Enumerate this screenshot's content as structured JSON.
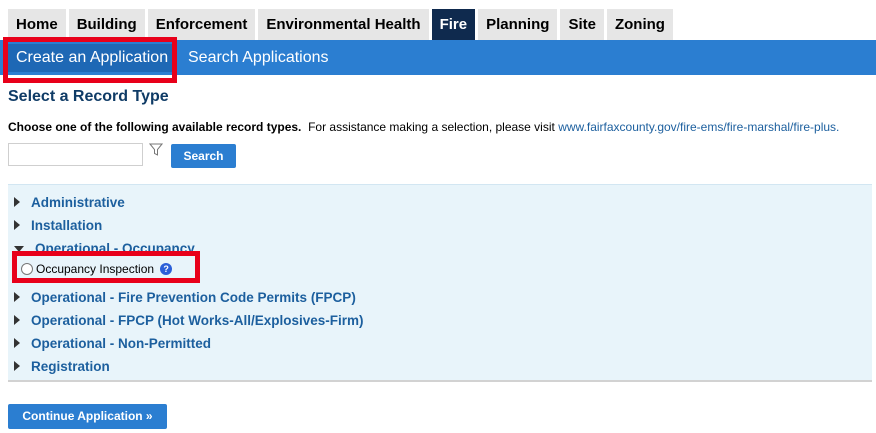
{
  "tabs": [
    {
      "label": "Home"
    },
    {
      "label": "Building"
    },
    {
      "label": "Enforcement"
    },
    {
      "label": "Environmental Health"
    },
    {
      "label": "Fire"
    },
    {
      "label": "Planning"
    },
    {
      "label": "Site"
    },
    {
      "label": "Zoning"
    }
  ],
  "active_tab": "Fire",
  "subnav": {
    "create_label": "Create an Application",
    "search_label": "Search Applications"
  },
  "page_title": "Select a Record Type",
  "instructions": {
    "bold_text": "Choose one of the following available record types.",
    "normal_text": "For assistance making a selection, please visit",
    "link_text": "www.fairfaxcounty.gov/fire-ems/fire-marshal/fire-plus."
  },
  "search": {
    "input_value": "",
    "button_label": "Search",
    "filter_icon": "filter-icon"
  },
  "record_types": [
    {
      "label": "Administrative",
      "expanded": false
    },
    {
      "label": "Installation",
      "expanded": false
    },
    {
      "label": "Operational - Occupancy",
      "expanded": true
    },
    {
      "label": "Operational - Fire Prevention Code Permits (FPCP)",
      "expanded": false
    },
    {
      "label": "Operational - FPCP (Hot Works-All/Explosives-Firm)",
      "expanded": false
    },
    {
      "label": "Operational - Non-Permitted",
      "expanded": false
    },
    {
      "label": "Registration",
      "expanded": false
    }
  ],
  "occupancy_option": {
    "label": "Occupancy Inspection",
    "selected": false,
    "help_icon": "help-icon"
  },
  "continue_label": "Continue Application »",
  "colors": {
    "nav_blue": "#2b7ed1",
    "active_tab": "#0f2a4e",
    "highlight_red": "#e8001a",
    "link_blue": "#1c5f9e",
    "panel_bg": "#e8f4fa"
  }
}
